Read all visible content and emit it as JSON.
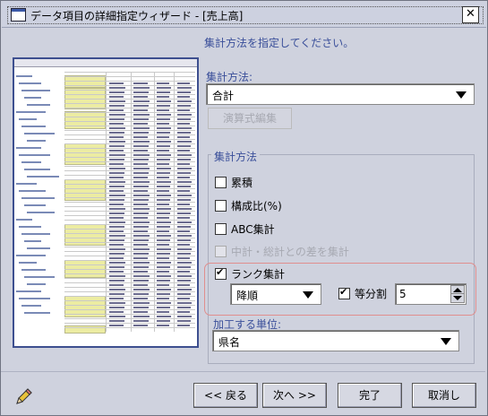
{
  "window": {
    "title": "データ項目の詳細指定ウィザード - [売上高]"
  },
  "instruction": "集計方法を指定してください。",
  "aggregation": {
    "label": "集計方法:",
    "selected": "合計",
    "formula_button": "演算式編集"
  },
  "group": {
    "title": "集計方法",
    "cumulative": "累積",
    "ratio": "構成比(%)",
    "abc": "ABC集計",
    "subtotal_diff": "中計・総計との差を集計",
    "rank": "ランク集計",
    "order": "降順",
    "equal_split": "等分割",
    "equal_split_value": "5"
  },
  "unit": {
    "label": "加工する単位:",
    "selected": "県名"
  },
  "buttons": {
    "back": "<< 戻る",
    "next": "次へ >>",
    "finish": "完了",
    "cancel": "取消し"
  },
  "icons": {
    "window": "window-icon",
    "close": "close-icon",
    "pencil": "pencil-icon"
  }
}
